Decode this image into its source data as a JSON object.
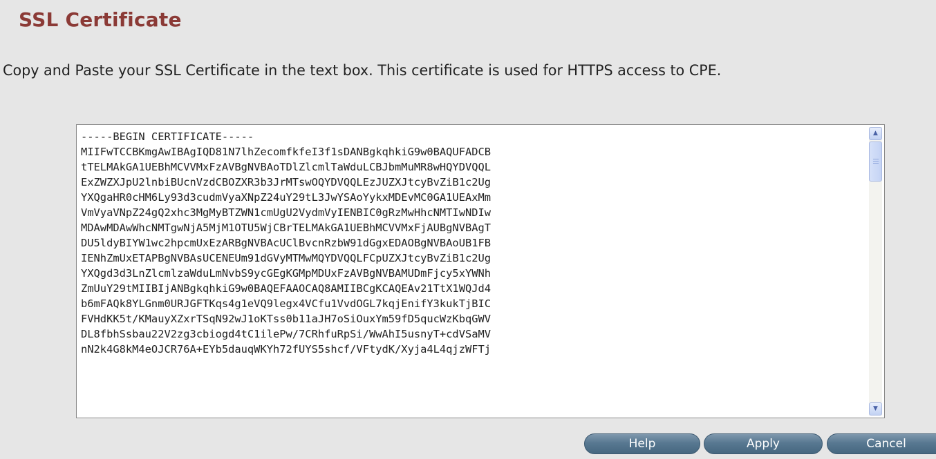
{
  "header": {
    "title": "SSL Certificate"
  },
  "description": "Copy and Paste your SSL Certificate in the text box. This certificate is used for HTTPS access to CPE.",
  "certificate": {
    "lines": [
      "-----BEGIN CERTIFICATE-----",
      "MIIFwTCCBKmgAwIBAgIQD81N7lhZecomfkfeI3f1sDANBgkqhkiG9w0BAQUFADCB",
      "tTELMAkGA1UEBhMCVVMxFzAVBgNVBAoTDlZlcmlTaWduLCBJbmMuMR8wHQYDVQQL",
      "ExZWZXJpU2lnbiBUcnVzdCBOZXR3b3JrMTswOQYDVQQLEzJUZXJtcyBvZiB1c2Ug",
      "YXQgaHR0cHM6Ly93d3cudmVyaXNpZ24uY29tL3JwYSAoYykxMDEvMC0GA1UEAxMm",
      "VmVyaVNpZ24gQ2xhc3MgMyBTZWN1cmUgU2VydmVyIENBIC0gRzMwHhcNMTIwNDIw",
      "MDAwMDAwWhcNMTgwNjA5MjM1OTU5WjCBrTELMAkGA1UEBhMCVVMxFjAUBgNVBAgT",
      "DU5ldyBIYW1wc2hpcmUxEzARBgNVBAcUClBvcnRzbW91dGgxEDAOBgNVBAoUB1FB",
      "IENhZmUxETAPBgNVBAsUCENEUm91dGVyMTMwMQYDVQQLFCpUZXJtcyBvZiB1c2Ug",
      "YXQgd3d3LnZlcmlzaWduLmNvbS9ycGEgKGMpMDUxFzAVBgNVBAMUDmFjcy5xYWNh",
      "ZmUuY29tMIIBIjANBgkqhkiG9w0BAQEFAAOCAQ8AMIIBCgKCAQEAv21TtX1WQJd4",
      "b6mFAQk8YLGnm0URJGFTKqs4g1eVQ9legx4VCfu1VvdOGL7kqjEnifY3kukTjBIC",
      "FVHdKK5t/KMauyXZxrTSqN92wJ1oKTss0b11aJH7oSiOuxYm59fD5qucWzKbqGWV",
      "DL8fbhSsbau22V2zg3cbiogd4tC1ilePw/7CRhfuRpSi/WwAhI5usnyT+cdVSaMV",
      "nN2k4G8kM4eOJCR76A+EYb5dauqWKYh72fUYS5shcf/VFtydK/Xyja4L4qjzWFTj"
    ]
  },
  "buttons": {
    "help": "Help",
    "apply": "Apply",
    "cancel": "Cancel"
  },
  "colors": {
    "title": "#8b3a36",
    "background": "#e6e6e6",
    "button": "#587891"
  }
}
